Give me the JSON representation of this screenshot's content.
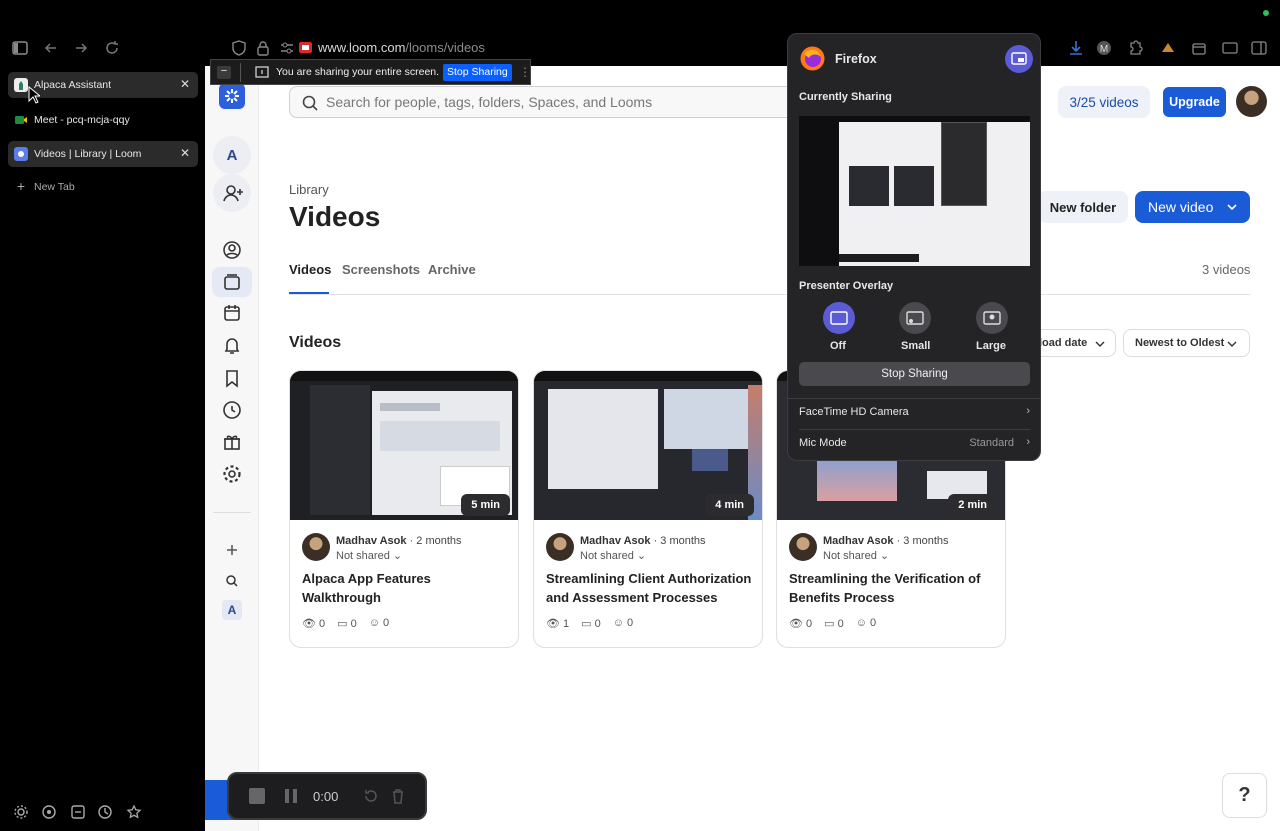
{
  "browser": {
    "url_domain": "www.loom.com",
    "url_path": "/looms/videos"
  },
  "sidebar": {
    "tabs": [
      {
        "label": "Alpaca Assistant",
        "active": true
      },
      {
        "label": "Meet - pcq-mcja-qqy",
        "active": false
      },
      {
        "label": "Videos | Library | Loom",
        "active": true
      }
    ],
    "new_tab": "New Tab"
  },
  "sharing_bar": {
    "message": "You are sharing your entire screen.",
    "stop_label": "Stop Sharing"
  },
  "search": {
    "placeholder": "Search for people, tags, folders, Spaces, and Looms"
  },
  "header": {
    "quota": "3/25 videos",
    "upgrade": "Upgrade"
  },
  "rail": {
    "workspace_initial": "A",
    "bottom_initial": "A"
  },
  "library": {
    "breadcrumb": "Library",
    "title": "Videos",
    "new_folder": "New folder",
    "new_video": "New video",
    "tabs": [
      "Videos",
      "Screenshots",
      "Archive"
    ],
    "active_tab": "Videos",
    "count": "3 videos",
    "section_title": "Videos",
    "sort_field": "load date",
    "sort_order": "Newest to Oldest"
  },
  "videos": [
    {
      "duration": "5 min",
      "author": "Madhav Asok",
      "age": "2 months",
      "share": "Not shared",
      "title": "Alpaca App Features Walkthrough",
      "views": "0",
      "comments": "0",
      "reactions": "0"
    },
    {
      "duration": "4 min",
      "author": "Madhav Asok",
      "age": "3 months",
      "share": "Not shared",
      "title": "Streamlining Client Authorization and Assessment Processes",
      "views": "1",
      "comments": "0",
      "reactions": "0"
    },
    {
      "duration": "2 min",
      "author": "Madhav Asok",
      "age": "3 months",
      "share": "Not shared",
      "title": "Streamlining the Verification of Benefits Process",
      "views": "0",
      "comments": "0",
      "reactions": "0"
    }
  ],
  "popup": {
    "app_name": "Firefox",
    "currently_sharing": "Currently Sharing",
    "presenter_overlay": "Presenter Overlay",
    "overlay_options": [
      "Off",
      "Small",
      "Large"
    ],
    "selected_overlay": "Off",
    "stop_sharing": "Stop Sharing",
    "camera": "FaceTime HD Camera",
    "mic_mode_label": "Mic Mode",
    "mic_mode_value": "Standard"
  },
  "recorder": {
    "timer": "0:00"
  },
  "help": {
    "label": "?"
  },
  "colors": {
    "accent": "#1665e8",
    "loom_blue": "#1a5bd8",
    "share_stop": "#0b5fff",
    "overlay_selected": "#5b5bd6"
  }
}
